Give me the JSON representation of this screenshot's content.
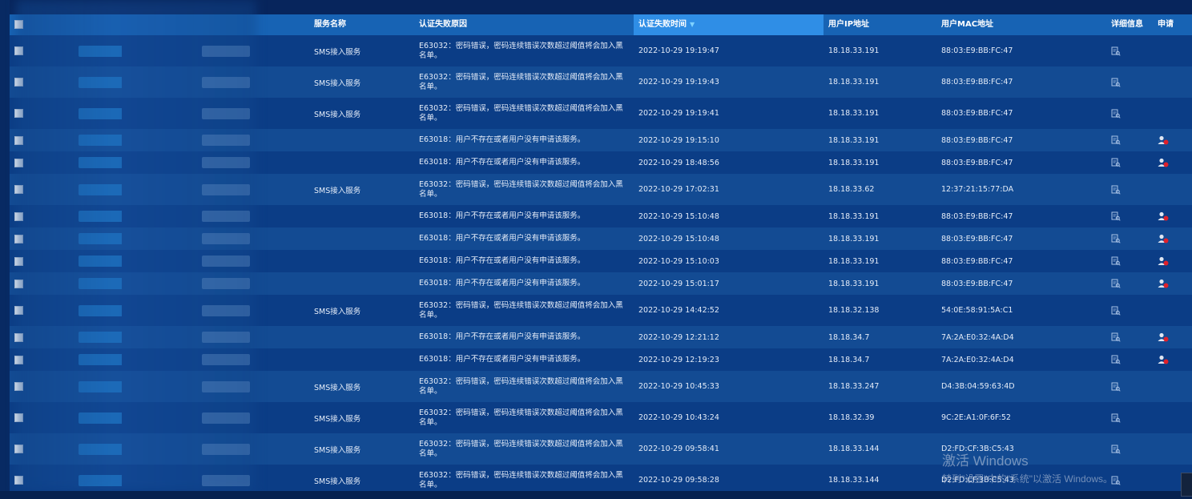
{
  "columns": {
    "service": "服务名称",
    "reason": "认证失败原因",
    "time": "认证失败时间",
    "ip": "用户IP地址",
    "mac": "用户MAC地址",
    "detail": "详细信息",
    "apply": "申请"
  },
  "icons": {
    "detail": "detail-magnifier-icon",
    "apply": "user-apply-icon",
    "sort": "sort-desc-icon"
  },
  "rows": [
    {
      "service": "SMS接入服务",
      "reason": "E63032：密码错误，密码连续错误次数超过阈值将会加入黑名单。",
      "time": "2022-10-29 19:19:47",
      "ip": "18.18.33.191",
      "mac": "88:03:E9:BB:FC:47",
      "apply": false
    },
    {
      "service": "SMS接入服务",
      "reason": "E63032：密码错误，密码连续错误次数超过阈值将会加入黑名单。",
      "time": "2022-10-29 19:19:43",
      "ip": "18.18.33.191",
      "mac": "88:03:E9:BB:FC:47",
      "apply": false
    },
    {
      "service": "SMS接入服务",
      "reason": "E63032：密码错误，密码连续错误次数超过阈值将会加入黑名单。",
      "time": "2022-10-29 19:19:41",
      "ip": "18.18.33.191",
      "mac": "88:03:E9:BB:FC:47",
      "apply": false
    },
    {
      "service": "",
      "reason": "E63018：用户不存在或者用户没有申请该服务。",
      "time": "2022-10-29 19:15:10",
      "ip": "18.18.33.191",
      "mac": "88:03:E9:BB:FC:47",
      "apply": true
    },
    {
      "service": "",
      "reason": "E63018：用户不存在或者用户没有申请该服务。",
      "time": "2022-10-29 18:48:56",
      "ip": "18.18.33.191",
      "mac": "88:03:E9:BB:FC:47",
      "apply": true
    },
    {
      "service": "SMS接入服务",
      "reason": "E63032：密码错误，密码连续错误次数超过阈值将会加入黑名单。",
      "time": "2022-10-29 17:02:31",
      "ip": "18.18.33.62",
      "mac": "12:37:21:15:77:DA",
      "apply": false
    },
    {
      "service": "",
      "reason": "E63018：用户不存在或者用户没有申请该服务。",
      "time": "2022-10-29 15:10:48",
      "ip": "18.18.33.191",
      "mac": "88:03:E9:BB:FC:47",
      "apply": true
    },
    {
      "service": "",
      "reason": "E63018：用户不存在或者用户没有申请该服务。",
      "time": "2022-10-29 15:10:48",
      "ip": "18.18.33.191",
      "mac": "88:03:E9:BB:FC:47",
      "apply": true
    },
    {
      "service": "",
      "reason": "E63018：用户不存在或者用户没有申请该服务。",
      "time": "2022-10-29 15:10:03",
      "ip": "18.18.33.191",
      "mac": "88:03:E9:BB:FC:47",
      "apply": true
    },
    {
      "service": "",
      "reason": "E63018：用户不存在或者用户没有申请该服务。",
      "time": "2022-10-29 15:01:17",
      "ip": "18.18.33.191",
      "mac": "88:03:E9:BB:FC:47",
      "apply": true
    },
    {
      "service": "SMS接入服务",
      "reason": "E63032：密码错误，密码连续错误次数超过阈值将会加入黑名单。",
      "time": "2022-10-29 14:42:52",
      "ip": "18.18.32.138",
      "mac": "54:0E:58:91:5A:C1",
      "apply": false
    },
    {
      "service": "",
      "reason": "E63018：用户不存在或者用户没有申请该服务。",
      "time": "2022-10-29 12:21:12",
      "ip": "18.18.34.7",
      "mac": "7A:2A:E0:32:4A:D4",
      "apply": true
    },
    {
      "service": "",
      "reason": "E63018：用户不存在或者用户没有申请该服务。",
      "time": "2022-10-29 12:19:23",
      "ip": "18.18.34.7",
      "mac": "7A:2A:E0:32:4A:D4",
      "apply": true
    },
    {
      "service": "SMS接入服务",
      "reason": "E63032：密码错误，密码连续错误次数超过阈值将会加入黑名单。",
      "time": "2022-10-29 10:45:33",
      "ip": "18.18.33.247",
      "mac": "D4:3B:04:59:63:4D",
      "apply": false
    },
    {
      "service": "SMS接入服务",
      "reason": "E63032：密码错误，密码连续错误次数超过阈值将会加入黑名单。",
      "time": "2022-10-29 10:43:24",
      "ip": "18.18.32.39",
      "mac": "9C:2E:A1:0F:6F:52",
      "apply": false
    },
    {
      "service": "SMS接入服务",
      "reason": "E63032：密码错误，密码连续错误次数超过阈值将会加入黑名单。",
      "time": "2022-10-29 09:58:41",
      "ip": "18.18.33.144",
      "mac": "D2:FD:CF:3B:C5:43",
      "apply": false
    },
    {
      "service": "SMS接入服务",
      "reason": "E63032：密码错误，密码连续错误次数超过阈值将会加入黑名单。",
      "time": "2022-10-29 09:58:28",
      "ip": "18.18.33.144",
      "mac": "D2:FD:CF:3B:C5:43",
      "apply": false
    }
  ],
  "watermark": {
    "line1": "激活 Windows",
    "line2": "转到\"设置\"中的\"系统\"以激活 Windows。"
  },
  "colors": {
    "header": "#1763b4",
    "header_sorted": "#2f8ee6",
    "row_odd": "#0b3d86",
    "row_even": "#134b93",
    "apply_red": "#e0202a"
  }
}
